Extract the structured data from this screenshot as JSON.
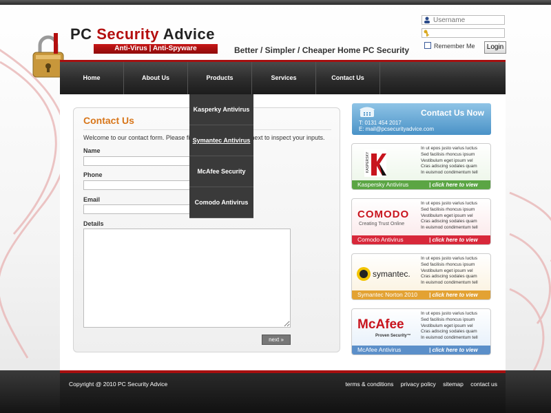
{
  "brand": {
    "title_part1": "PC ",
    "title_part2": "Security",
    "title_part3": " Advice",
    "tagline": "Anti-Virus | Anti-Spyware",
    "slogan": "Better / Simpler / Cheaper Home PC Security"
  },
  "login": {
    "username_placeholder": "Username",
    "password_value": "",
    "remember_label": "Remember Me",
    "login_button": "Login"
  },
  "nav": {
    "items": [
      "Home",
      "About Us",
      "Products",
      "Services",
      "Contact Us"
    ]
  },
  "products_menu": {
    "items": [
      "Kasperky Antivirus",
      "Symantec Antivirus",
      "McAfee Security",
      "Comodo Antivirus"
    ],
    "active_index": 1
  },
  "contact_form": {
    "heading": "Contact Us",
    "intro": "Welcome to our contact form. Please fill in the form and click next to inspect your inputs.",
    "name_label": "Name",
    "phone_label": "Phone",
    "email_label": "Email",
    "details_label": "Details",
    "next_button": "next »"
  },
  "contact_now": {
    "title": "Contact Us Now",
    "phone": "T: 0131 454 2017",
    "email": "E: mail@pcsecurityadvice.com"
  },
  "ads": [
    {
      "name": "Kaspersky Antivirus",
      "cta": "|  click here to view",
      "strip_color": "#5ba544",
      "desc": [
        "In ut epos justo varius luctus",
        "Sed facilisis rhoncus ipsum",
        "Vestibulum eget ipsum vel",
        "Cras adiscing sodales quam",
        "In euismod condimentum tell"
      ]
    },
    {
      "name": "Comodo Antivirus",
      "cta": "|  click here to view",
      "strip_color": "#d8283a",
      "logo_text": "COMODO",
      "logo_sub": "Creating Trust Online",
      "desc": [
        "In ut epos justo varius luctus",
        "Sed facilisis rhoncus ipsum",
        "Vestibulum eget ipsum vel",
        "Cras adiscing sodales quam",
        "In euismod condimentum tell"
      ]
    },
    {
      "name": "Symantec Norton 2010",
      "cta": "|  click here to view",
      "strip_color": "#e3a233",
      "logo_text": "symantec.",
      "desc": [
        "In ut epos justo varius luctus",
        "Sed facilisis rhoncus ipsum",
        "Vestibulum eget ipsum vel",
        "Cras adiscing sodales quam",
        "In euismod condimentum tell"
      ]
    },
    {
      "name": "McAfee Antivirus",
      "cta": "|  click here to view",
      "strip_color": "#5b8fc9",
      "logo_text": "McAfee",
      "logo_sub": "Proven Security™",
      "desc": [
        "In ut epos justo varius luctus",
        "Sed facilisis rhoncus ipsum",
        "Vestibulum eget ipsum vel",
        "Cras adiscing sodales quam",
        "In euismod condimentum tell"
      ]
    }
  ],
  "footer": {
    "copyright": "Copyright @ 2010 PC Security Advice",
    "links": [
      "terms & conditions",
      "privacy policy",
      "sitemap",
      "contact us"
    ]
  },
  "colors": {
    "brand_red": "#b40f0f",
    "heading_orange": "#d8761a",
    "nav_dark": "#2e2e2e",
    "contact_blue": "#4a92c7"
  }
}
